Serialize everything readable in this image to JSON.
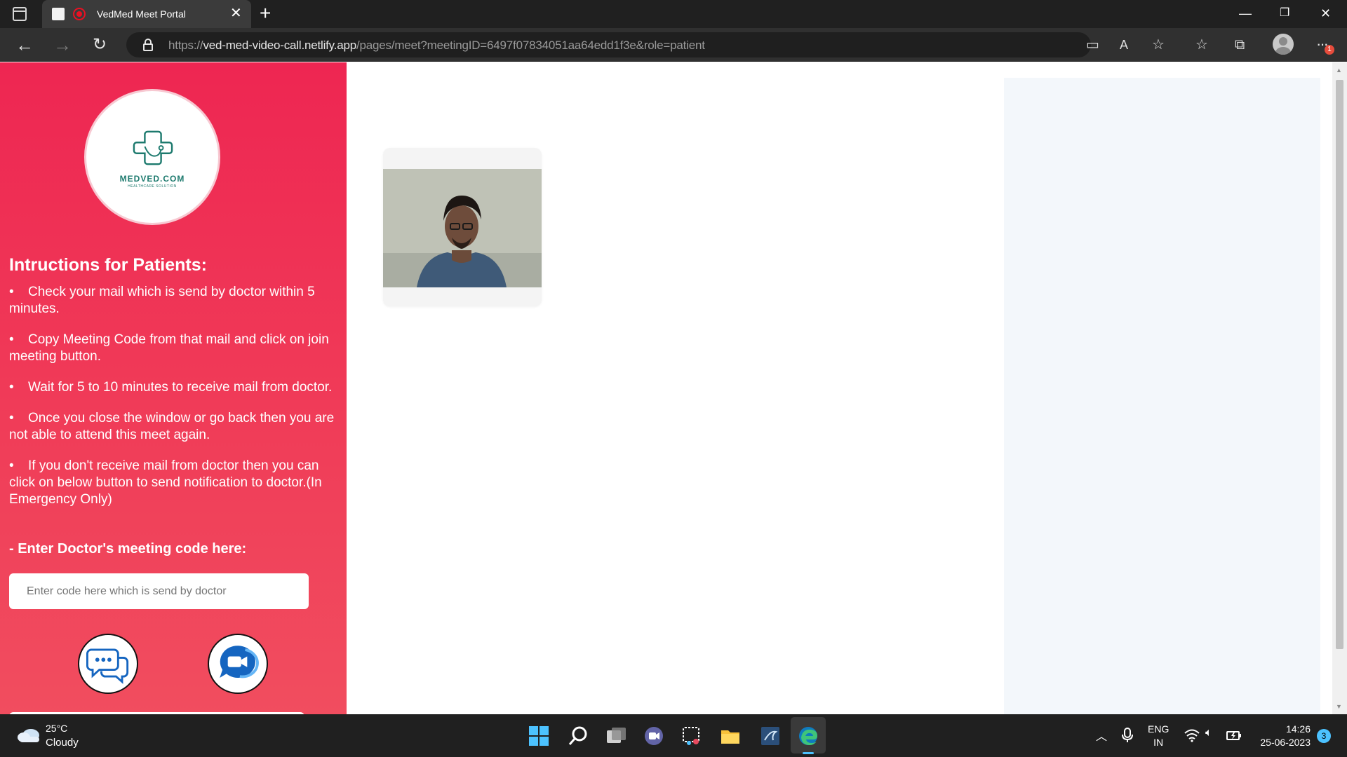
{
  "browser": {
    "tab_title": "VedMed Meet Portal",
    "url_scheme": "https://",
    "url_host": "ved-med-video-call.netlify.app",
    "url_path": "/pages/meet?meetingID=6497f07834051aa64edd1f3e&role=patient",
    "notification_count": "1"
  },
  "logo": {
    "name": "MEDVED.COM",
    "tagline": "HEALTHCARE SOLUTION",
    "brand_color": "#1d7a6e"
  },
  "sidebar": {
    "accent_color": "#ee2652",
    "instructions_title": "Intructions for Patients:",
    "bullet": "•",
    "instructions": [
      "Check your mail which is send by doctor within 5 minutes.",
      "Copy Meeting Code from that mail and click on join meeting button.",
      "Wait for 5 to 10 minutes to receive mail from doctor.",
      "Once you close the window or go back then you are not able to attend this meet again.",
      "If you don't receive mail from doctor then you can click on below button to send notification to doctor.(In Emergency Only)"
    ],
    "code_label": "- Enter Doctor's meeting code here:",
    "code_placeholder": "Enter code here which is send by doctor",
    "chat_icon": "chat-bubbles-icon",
    "video_icon": "video-call-icon"
  },
  "taskbar": {
    "temperature": "25°C",
    "weather": "Cloudy",
    "lang_top": "ENG",
    "lang_bottom": "IN",
    "time": "14:26",
    "date": "25-06-2023",
    "notifications": "3"
  }
}
